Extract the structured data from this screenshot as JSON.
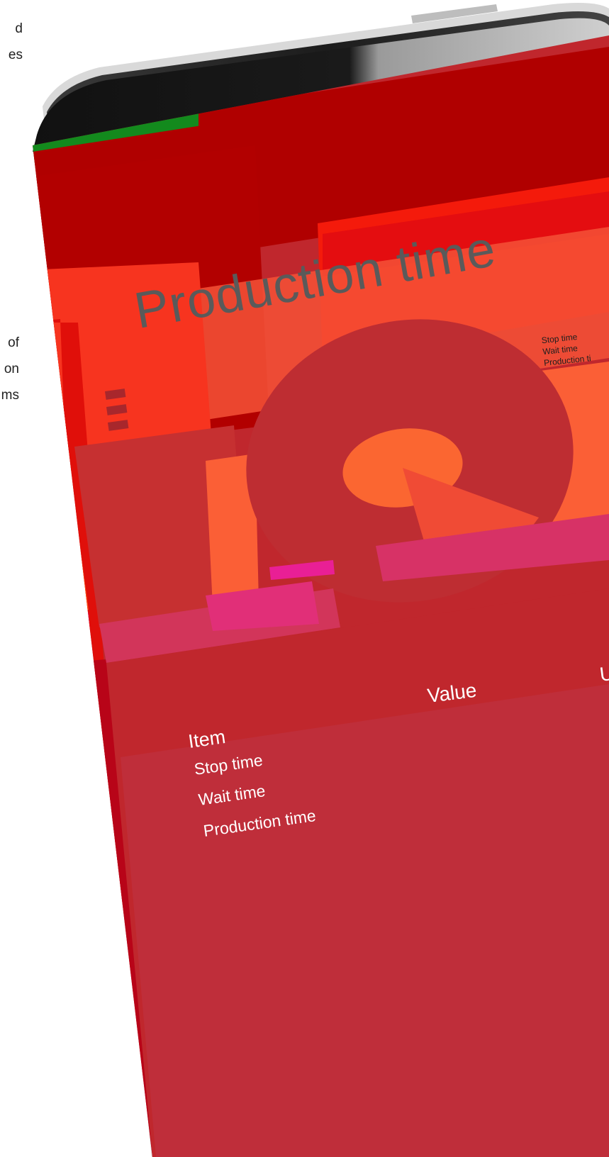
{
  "side_text": {
    "top_lines": [
      "d",
      "es"
    ],
    "middle_lines": [
      "of",
      "on",
      "ms"
    ]
  },
  "screen": {
    "title": "Production time",
    "legend": [
      "Stop time",
      "Wait time",
      "Production ti"
    ],
    "table": {
      "headers": {
        "item": "Item",
        "value": "Value",
        "unit": "U"
      },
      "rows": [
        "Stop time",
        "Wait time",
        "Production time"
      ]
    }
  },
  "colors": {
    "screen_dark_red": "#b00000",
    "screen_red": "#c0272d",
    "bright_red": "#f0190a",
    "orange": "#fb5f36",
    "pink": "#dd2f72",
    "title_gray": "#5a5a5a",
    "phone_frame": "#2a2a2a"
  }
}
